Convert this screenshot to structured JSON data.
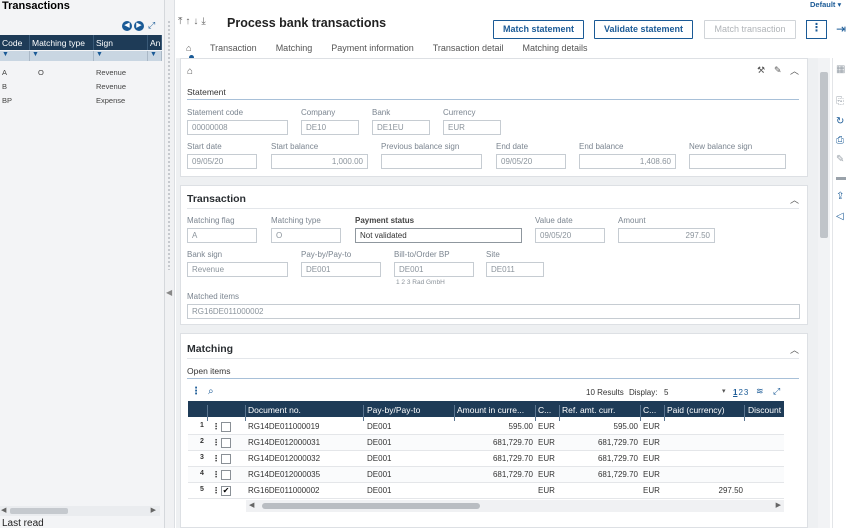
{
  "left_panel": {
    "title": "Transactions",
    "columns": [
      "Code",
      "Matching type",
      "Sign",
      "An"
    ],
    "rows": [
      {
        "code": "A",
        "matching_type": "O",
        "sign": "Revenue"
      },
      {
        "code": "B",
        "matching_type": "",
        "sign": "Revenue"
      },
      {
        "code": "BP",
        "matching_type": "",
        "sign": "Expense"
      }
    ],
    "footer_label": "Last read"
  },
  "header": {
    "default_label": "Default",
    "title": "Process bank transactions",
    "match_statement": "Match statement",
    "validate_statement": "Validate statement",
    "match_transaction": "Match transaction",
    "kebab": "⋮",
    "exit_icon": "exit-icon"
  },
  "tabs": [
    "Transaction",
    "Matching",
    "Payment information",
    "Transaction detail",
    "Matching details"
  ],
  "statement": {
    "title": "Statement",
    "code_label": "Statement code",
    "code": "00000008",
    "company_label": "Company",
    "company": "DE10",
    "bank_label": "Bank",
    "bank": "DE1EU",
    "currency_label": "Currency",
    "currency": "EUR",
    "start_date_label": "Start date",
    "start_date": "09/05/20",
    "start_balance_label": "Start balance",
    "start_balance": "1,000.00",
    "prev_sign_label": "Previous balance sign",
    "prev_sign": "",
    "end_date_label": "End date",
    "end_date": "09/05/20",
    "end_balance_label": "End balance",
    "end_balance": "1,408.60",
    "new_sign_label": "New balance sign",
    "new_sign": ""
  },
  "transaction": {
    "title": "Transaction",
    "matching_flag_label": "Matching flag",
    "matching_flag": "A",
    "matching_type_label": "Matching type",
    "matching_type": "O",
    "payment_status_label": "Payment status",
    "payment_status": "Not validated",
    "value_date_label": "Value date",
    "value_date": "09/05/20",
    "amount_label": "Amount",
    "amount": "297.50",
    "bank_sign_label": "Bank sign",
    "bank_sign": "Revenue",
    "pay_by_label": "Pay-by/Pay-to",
    "pay_by": "DE001",
    "bill_to_label": "Bill-to/Order BP",
    "bill_to": "DE001",
    "bill_to_name": "1 2 3 Rad GmbH",
    "site_label": "Site",
    "site": "DE011",
    "matched_items_label": "Matched items",
    "matched_items": "RG16DE011000002"
  },
  "matching": {
    "title": "Matching",
    "open_items_label": "Open items",
    "results": "10 Results",
    "display_label": "Display:",
    "display_value": "5",
    "pages": [
      "1",
      "2",
      "3"
    ],
    "columns": [
      "Document no.",
      "Pay-by/Pay-to",
      "Amount in curre...",
      "C...",
      "Ref. amt. curr.",
      "C...",
      "Paid (currency)",
      "Discount"
    ],
    "rows": [
      {
        "n": "1",
        "checked": "",
        "doc": "RG14DE011000019",
        "pay": "DE001",
        "amt": "595.00",
        "cur": "EUR",
        "ref": "595.00",
        "cur2": "EUR",
        "paid": ""
      },
      {
        "n": "2",
        "checked": "",
        "doc": "RG14DE012000031",
        "pay": "DE001",
        "amt": "681,729.70",
        "cur": "EUR",
        "ref": "681,729.70",
        "cur2": "EUR",
        "paid": ""
      },
      {
        "n": "3",
        "checked": "",
        "doc": "RG14DE012000032",
        "pay": "DE001",
        "amt": "681,729.70",
        "cur": "EUR",
        "ref": "681,729.70",
        "cur2": "EUR",
        "paid": ""
      },
      {
        "n": "4",
        "checked": "",
        "doc": "RG14DE012000035",
        "pay": "DE001",
        "amt": "681,729.70",
        "cur": "EUR",
        "ref": "681,729.70",
        "cur2": "EUR",
        "paid": ""
      },
      {
        "n": "5",
        "checked": "✔",
        "doc": "RG16DE011000002",
        "pay": "DE001",
        "amt": "",
        "cur": "EUR",
        "ref": "",
        "cur2": "EUR",
        "paid": "297.50"
      }
    ]
  }
}
